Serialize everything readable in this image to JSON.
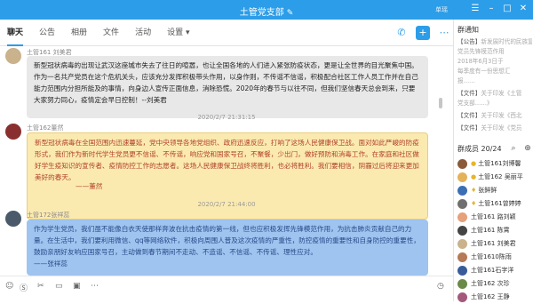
{
  "window": {
    "title": "土管党支部",
    "user_name": "单瑶",
    "controls": [
      "设置",
      "最小化",
      "最大化",
      "关闭"
    ]
  },
  "tabs": [
    {
      "label": "聊天",
      "active": true
    },
    {
      "label": "公告",
      "active": false
    },
    {
      "label": "相册",
      "active": false
    },
    {
      "label": "文件",
      "active": false
    },
    {
      "label": "活动",
      "active": false
    },
    {
      "label": "设置 ▾",
      "active": false
    }
  ],
  "messages": [
    {
      "sender": "土管161 刘美君",
      "text": "新型冠状病毒的出现让武汉这座城市失去了往日的喧嚣，也让全国各地的人们进入紧张防疫状态，更是让全世界的目光聚焦中国。作为一名共产党员在这个危机关头，应该充分发挥积极带头作用，以身作则，不传谣不信谣，积极配合社区工作人员工作并在自己能力范围内分担所能及的事情，向身边人宣传正面信息，消除恐慌。2020年的春节与以往不同，但我们坚信春天总会到来，只要大家努力同心，疫情定会早日控制！--刘美君"
    },
    {
      "timestamp": "2020/2/7 21:31:15",
      "sender": "土管162董然",
      "text": "新型冠状病毒在全国范围内迅速蔓延，党中央领导各地党组织、政府迅速反应，打响了这场人民健康保卫战。面对如此严峻的防疫形式，我们作为新时代学生党员更不信谣、不传谣，响应党和国家号召，不聚餐，少出门，做好预防和消毒工作。在家庭和社区做好学生疫知识的宣传者、疫情防控工作的志愿者。这场人民健康保卫战终将胜利，也必将胜利。我们要相信，阴霾过后将迎来更加美好的春天。",
      "signature": "——董然"
    },
    {
      "timestamp": "2020/2/7 21:44:00",
      "sender": "土管172张祥蕊",
      "text": "作为学生党员，我们虽不能像白衣天使那样奔波在抗击疫情的第一线，但也应积极发挥先锋模范作用，为抗击肺炎贡献自己的力量。在生活中，我们要利用微信、qq等网络软件，积极向周围人普及这次疫情的严重性，防控疫情的重要性和自身防控的重要性，鼓励亲朋好友响应国家号召，主动做到春节期间不走动、不造谣、不信谣、不传谣、理性应对。\n——张祥蕊"
    }
  ],
  "input_tools": [
    "表情",
    "超级表情",
    "截图",
    "文件",
    "图片",
    "更多"
  ],
  "history_icon": "history-icon",
  "sidebar": {
    "notice_title": "群通知",
    "notices": [
      {
        "tag": "【公告】",
        "text": "新发展时代的民族复兴"
      },
      {
        "tag": "",
        "text": "党员先锋模范作用"
      },
      {
        "tag": "",
        "text": "2018年6月3日于"
      },
      {
        "tag": "",
        "text": "每季度有一份思想汇"
      },
      {
        "tag": "",
        "text": "报……"
      },
      {
        "tag": "【文件】",
        "text": "关于印发《土管"
      },
      {
        "tag": "",
        "text": "党支部……》"
      },
      {
        "tag": "【文件】",
        "text": "关于印发《西北"
      },
      {
        "tag": "【文件】",
        "text": "关于印发《党员"
      }
    ],
    "members_title": "群成员 20/24",
    "members": [
      {
        "name": "土管161刘博馨",
        "icon": "●",
        "color": "#8a5a3a"
      },
      {
        "name": "土管162 吴丽平",
        "icon": "●",
        "color": "#e4b25a"
      },
      {
        "name": "张鲜鲜",
        "icon": "♦",
        "color": "#3c6eb4"
      },
      {
        "name": "土管161曾婷婷",
        "icon": "♦",
        "color": "#6f6f6f"
      },
      {
        "name": "土管161 路刘颖",
        "icon": "",
        "color": "#e6a07a"
      },
      {
        "name": "土管161 陈霄",
        "icon": "",
        "color": "#444"
      },
      {
        "name": "土管161 刘美君",
        "icon": "",
        "color": "#c9b28c"
      },
      {
        "name": "土管1610陈雨",
        "icon": "",
        "color": "#b57a57"
      },
      {
        "name": "土管161石字洋",
        "icon": "",
        "color": "#3a5b9a"
      },
      {
        "name": "土管162 次珍",
        "icon": "",
        "color": "#6a8a4a"
      },
      {
        "name": "土管162 王静",
        "icon": "",
        "color": "#a35a7a"
      }
    ]
  }
}
